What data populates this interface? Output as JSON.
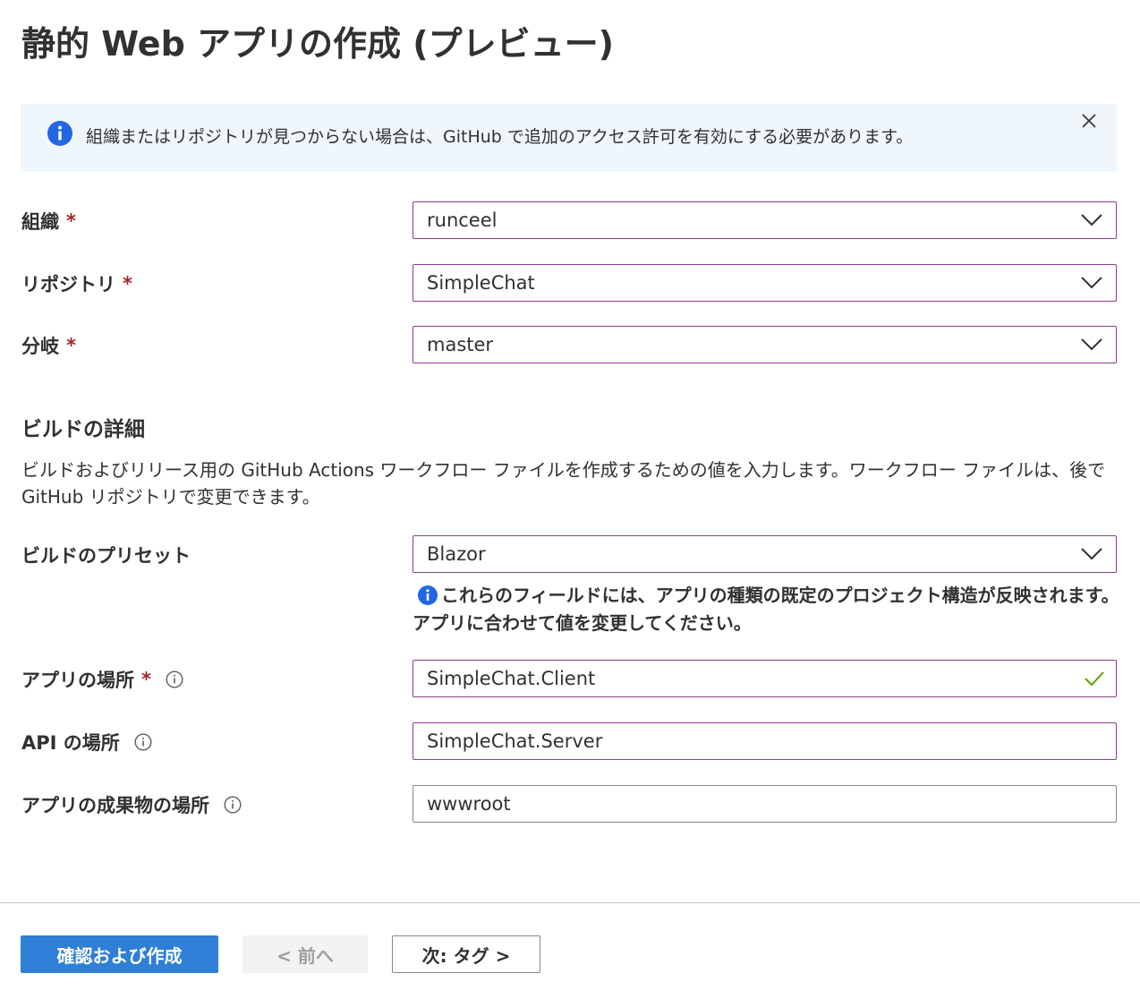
{
  "page": {
    "title": "静的 Web アプリの作成 (プレビュー)"
  },
  "banner": {
    "text": "組織またはリポジトリが見つからない場合は、GitHub で追加のアクセス許可を有効にする必要があります。"
  },
  "source": {
    "organization": {
      "label": "組織",
      "required": "*",
      "value": "runceel"
    },
    "repository": {
      "label": "リポジトリ",
      "required": "*",
      "value": "SimpleChat"
    },
    "branch": {
      "label": "分岐",
      "required": "*",
      "value": "master"
    }
  },
  "build": {
    "heading": "ビルドの詳細",
    "description": "ビルドおよびリリース用の GitHub Actions ワークフロー ファイルを作成するための値を入力します。ワークフロー ファイルは、後で GitHub リポジトリで変更できます。",
    "preset": {
      "label": "ビルドのプリセット",
      "value": "Blazor"
    },
    "preset_note": "これらのフィールドには、アプリの種類の既定のプロジェクト構造が反映されます。アプリに合わせて値を変更してください。",
    "app_location": {
      "label": "アプリの場所",
      "required": "*",
      "value": "SimpleChat.Client"
    },
    "api_location": {
      "label": "API の場所",
      "value": "SimpleChat.Server"
    },
    "artifact_location": {
      "label": "アプリの成果物の場所",
      "value": "wwwroot"
    }
  },
  "footer": {
    "review_create": "確認および作成",
    "previous": "< 前へ",
    "next": "次: タグ >"
  },
  "colors": {
    "accent": "#2f7fd6",
    "focus_border": "#8a3d8f",
    "required": "#a4262c",
    "banner_bg": "#eff6fc",
    "valid": "#57a300"
  }
}
